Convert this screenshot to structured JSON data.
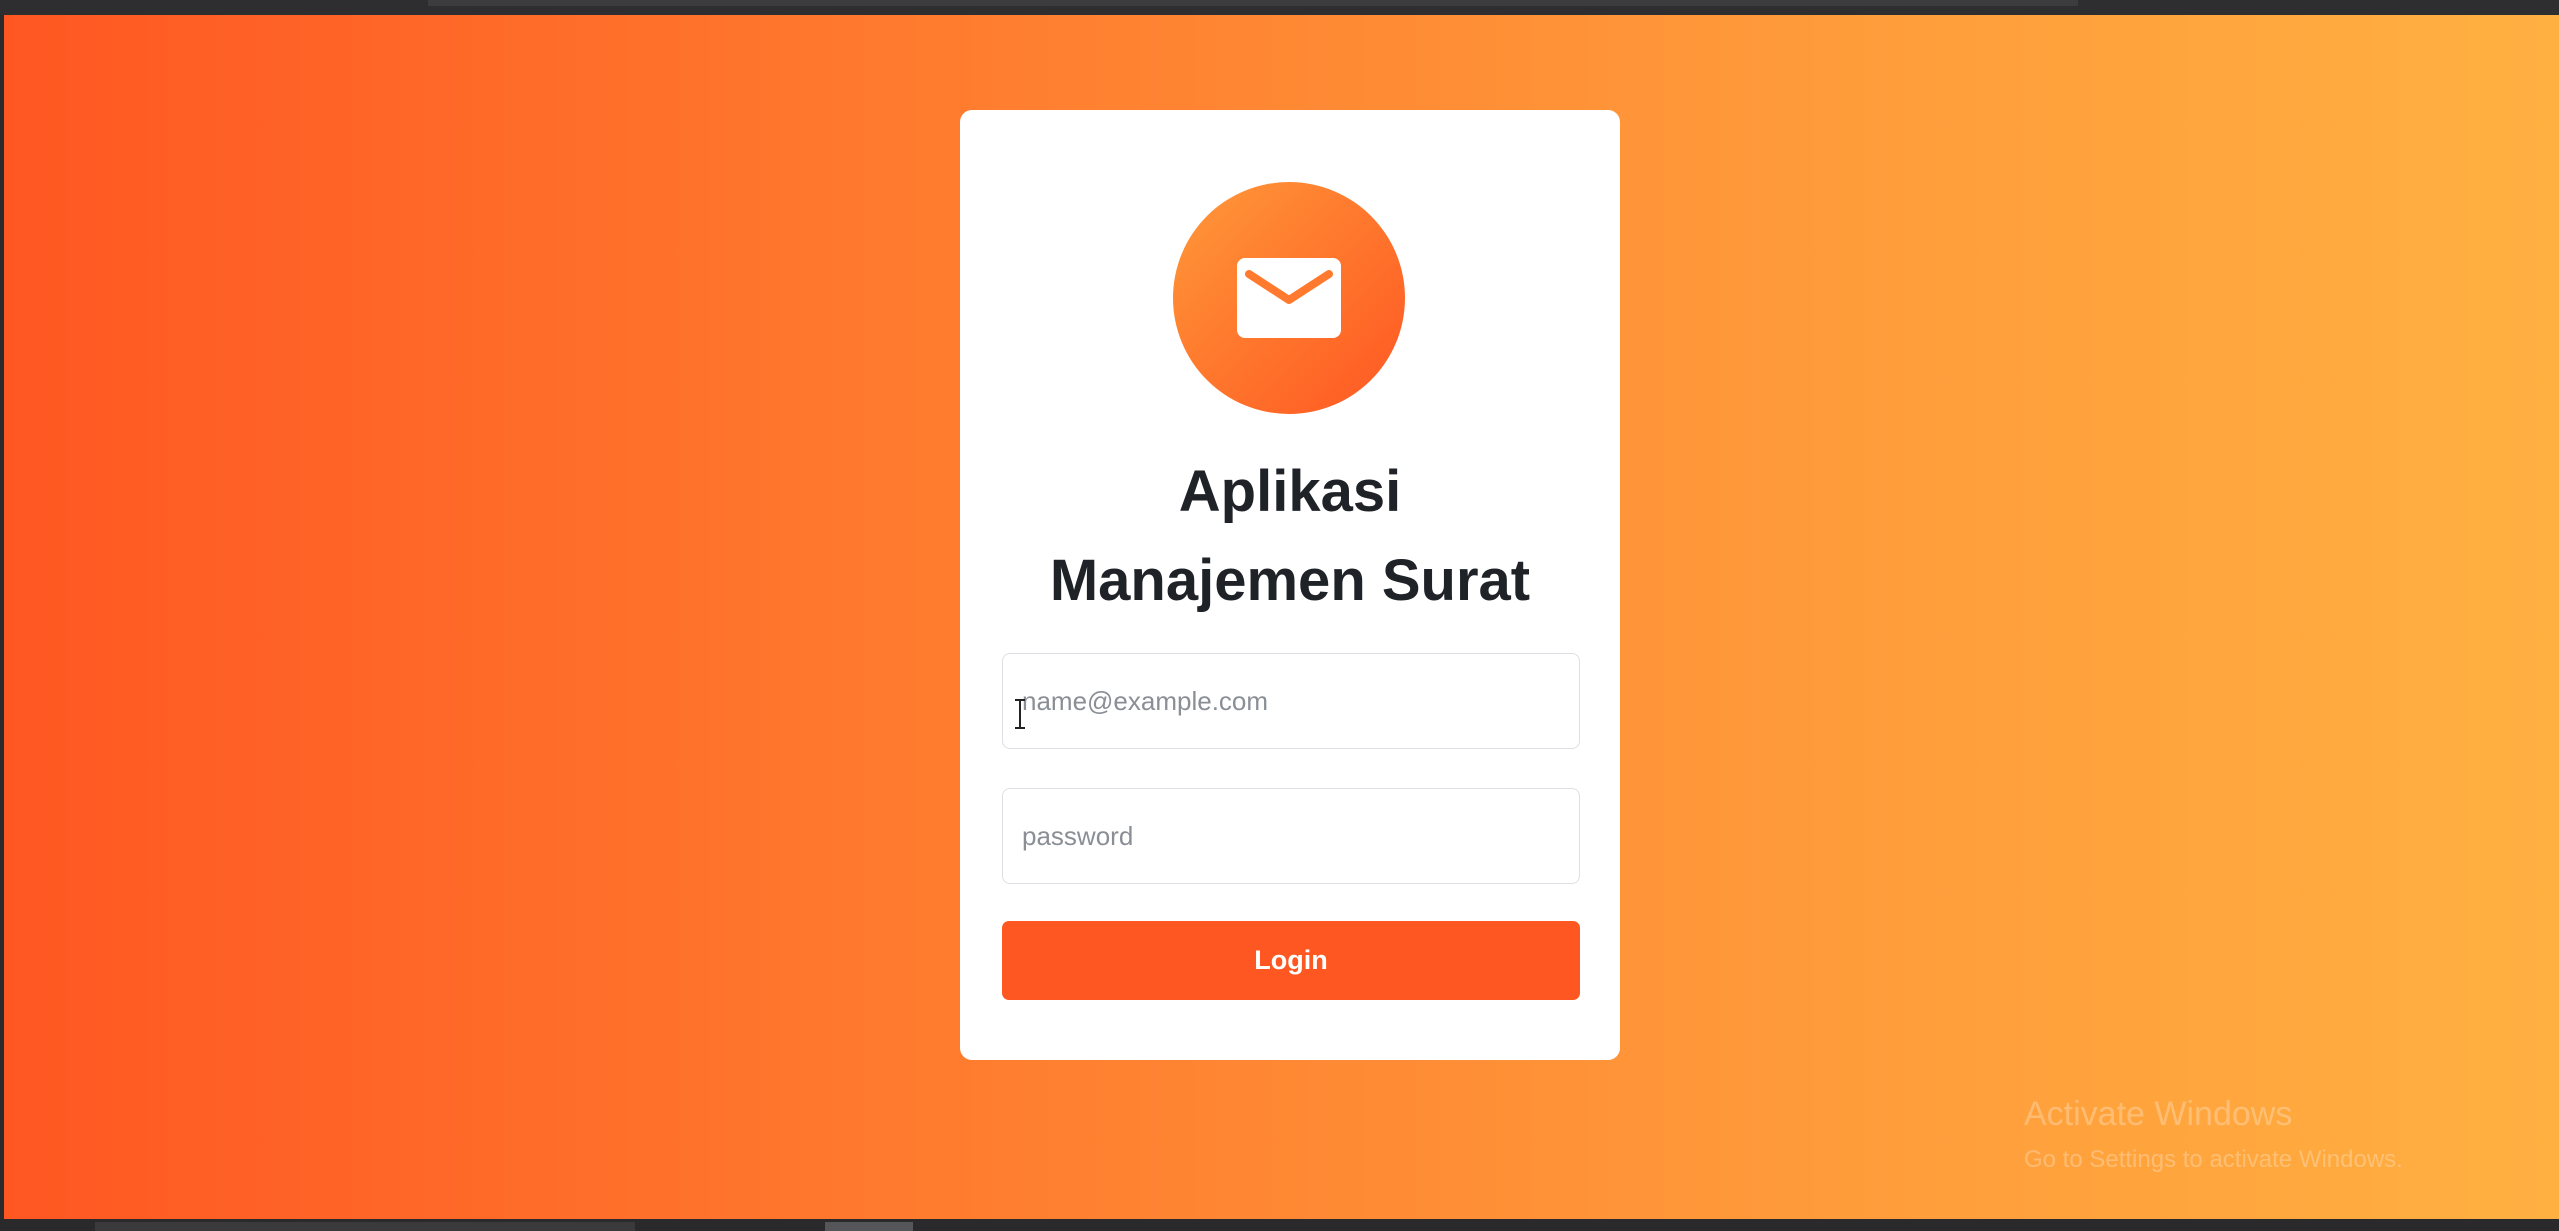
{
  "app": {
    "title_line1": "Aplikasi",
    "title_line2": "Manajemen Surat",
    "logo_icon": "envelope-icon"
  },
  "form": {
    "email_placeholder": "name@example.com",
    "password_placeholder": "password",
    "login_label": "Login"
  },
  "watermark": {
    "line1": "Activate Windows",
    "line2": "Go to Settings to activate Windows."
  },
  "colors": {
    "gradient_start": "#ff5722",
    "gradient_end": "#ffb041",
    "button": "#ff5722",
    "title_text": "#1f2328"
  }
}
